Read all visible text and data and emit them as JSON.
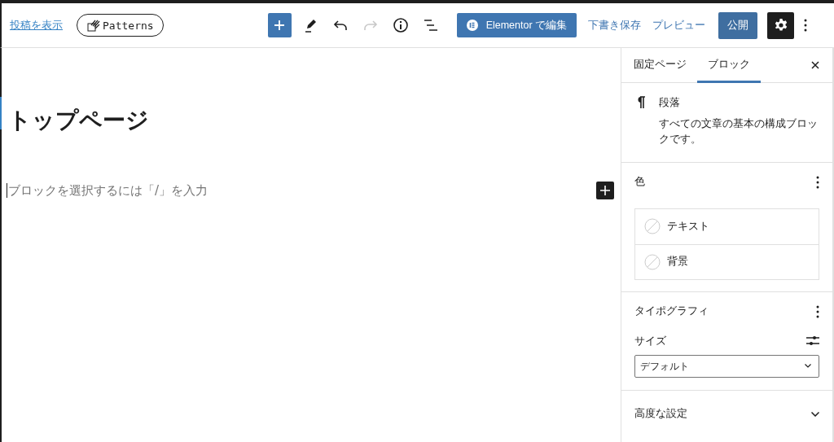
{
  "header": {
    "view_post_link": "投稿を表示",
    "patterns_button": "Patterns",
    "tools": [
      {
        "kind": "inserter",
        "disabled": false
      },
      {
        "kind": "edit",
        "disabled": false
      },
      {
        "kind": "undo",
        "disabled": false
      },
      {
        "kind": "redo",
        "disabled": true
      },
      {
        "kind": "info",
        "disabled": false
      },
      {
        "kind": "outline",
        "disabled": false
      }
    ],
    "elementor_button": "Elementor で編集",
    "save_draft": "下書き保存",
    "preview": "プレビュー",
    "publish": "公開",
    "settings_pressed": true
  },
  "editor": {
    "title": "トップページ",
    "placeholder": "ブロックを選択するには「/」を入力"
  },
  "sidebar": {
    "tabs": [
      {
        "label": "固定ページ",
        "selected": false
      },
      {
        "label": "ブロック",
        "selected": true
      }
    ],
    "block": {
      "name": "段落",
      "description": "すべての文章の基本の構成ブロックです。"
    },
    "color_panel": {
      "title": "色",
      "items": [
        "テキスト",
        "背景"
      ]
    },
    "typography_panel": {
      "title": "タイポグラフィ",
      "size_label": "サイズ",
      "size_value": "デフォルト"
    },
    "advanced_panel": {
      "title": "高度な設定",
      "expanded": false
    }
  }
}
